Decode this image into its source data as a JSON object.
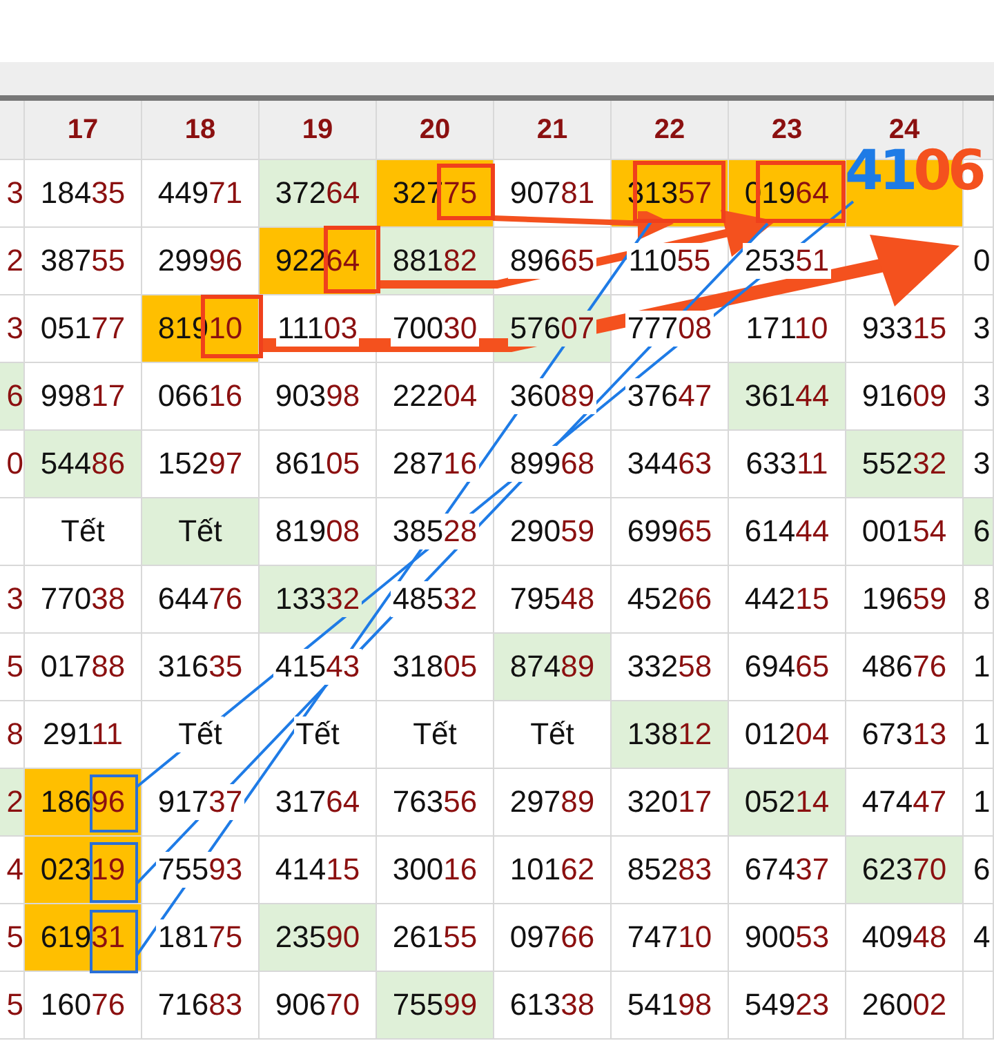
{
  "table": {
    "columns": [
      "17",
      "18",
      "19",
      "20",
      "21",
      "22",
      "23",
      "24"
    ],
    "rows": [
      {
        "left": {
          "value": "3"
        },
        "cells": [
          {
            "value": "18435"
          },
          {
            "value": "44971"
          },
          {
            "value": "37264",
            "color": "#dff0d8"
          },
          {
            "value": "32775",
            "color": "#ffbf00"
          },
          {
            "value": "90781"
          },
          {
            "value": "31357",
            "color": "#ffbf00"
          },
          {
            "value": "01964",
            "color": "#ffbf00"
          },
          {
            "color": "#ffbf00"
          }
        ]
      },
      {
        "left": {
          "value": "2"
        },
        "cells": [
          {
            "value": "38755"
          },
          {
            "value": "29996"
          },
          {
            "value": "92264",
            "color": "#ffbf00"
          },
          {
            "value": "88182",
            "color": "#dff0d8"
          },
          {
            "value": "89665"
          },
          {
            "value": "11055"
          },
          {
            "value": "25351"
          },
          {}
        ],
        "right": {
          "value": "0"
        }
      },
      {
        "left": {
          "value": "3"
        },
        "cells": [
          {
            "value": "05177"
          },
          {
            "value": "81910",
            "color": "#ffbf00"
          },
          {
            "value": "11103"
          },
          {
            "value": "70030"
          },
          {
            "value": "57607",
            "color": "#dff0d8"
          },
          {
            "value": "77708"
          },
          {
            "value": "17110"
          },
          {
            "value": "93315"
          }
        ],
        "right": {
          "value": "3"
        }
      },
      {
        "left": {
          "value": "6",
          "color": "#dff0d8"
        },
        "cells": [
          {
            "value": "99817"
          },
          {
            "value": "06616"
          },
          {
            "value": "90398"
          },
          {
            "value": "22204"
          },
          {
            "value": "36089"
          },
          {
            "value": "37647"
          },
          {
            "value": "36144",
            "color": "#dff0d8"
          },
          {
            "value": "91609"
          }
        ],
        "right": {
          "value": "3"
        }
      },
      {
        "left": {
          "value": "0"
        },
        "cells": [
          {
            "value": "54486",
            "color": "#dff0d8"
          },
          {
            "value": "15297"
          },
          {
            "value": "86105"
          },
          {
            "value": "28716"
          },
          {
            "value": "89968"
          },
          {
            "value": "34463"
          },
          {
            "value": "63311"
          },
          {
            "value": "55232",
            "color": "#dff0d8"
          }
        ],
        "right": {
          "value": "3"
        }
      },
      {
        "cells": [
          {
            "value": "Tết",
            "kind": "holiday"
          },
          {
            "value": "Tết",
            "kind": "holiday",
            "color": "#dff0d8"
          },
          {
            "value": "81908"
          },
          {
            "value": "38528"
          },
          {
            "value": "29059"
          },
          {
            "value": "69965"
          },
          {
            "value": "61444"
          },
          {
            "value": "00154"
          }
        ],
        "right": {
          "value": "6",
          "color": "#dff0d8"
        }
      },
      {
        "left": {
          "value": "3"
        },
        "cells": [
          {
            "value": "77038"
          },
          {
            "value": "64476"
          },
          {
            "value": "13332",
            "color": "#dff0d8"
          },
          {
            "value": "48532"
          },
          {
            "value": "79548"
          },
          {
            "value": "45266"
          },
          {
            "value": "44215"
          },
          {
            "value": "19659"
          }
        ],
        "right": {
          "value": "8"
        }
      },
      {
        "left": {
          "value": "5"
        },
        "cells": [
          {
            "value": "01788"
          },
          {
            "value": "31635"
          },
          {
            "value": "41543"
          },
          {
            "value": "31805"
          },
          {
            "value": "87489",
            "color": "#dff0d8"
          },
          {
            "value": "33258"
          },
          {
            "value": "69465"
          },
          {
            "value": "48676"
          }
        ],
        "right": {
          "value": "1"
        }
      },
      {
        "left": {
          "value": "8"
        },
        "cells": [
          {
            "value": "29111"
          },
          {
            "value": "Tết",
            "kind": "holiday"
          },
          {
            "value": "Tết",
            "kind": "holiday"
          },
          {
            "value": "Tết",
            "kind": "holiday"
          },
          {
            "value": "Tết",
            "kind": "holiday"
          },
          {
            "value": "13812",
            "color": "#dff0d8"
          },
          {
            "value": "01204"
          },
          {
            "value": "67313"
          }
        ],
        "right": {
          "value": "1"
        }
      },
      {
        "left": {
          "value": "2",
          "color": "#dff0d8"
        },
        "cells": [
          {
            "value": "18696",
            "color": "#ffbf00"
          },
          {
            "value": "91737"
          },
          {
            "value": "31764"
          },
          {
            "value": "76356"
          },
          {
            "value": "29789"
          },
          {
            "value": "32017"
          },
          {
            "value": "05214",
            "color": "#dff0d8"
          },
          {
            "value": "47447"
          }
        ],
        "right": {
          "value": "1"
        }
      },
      {
        "left": {
          "value": "4"
        },
        "cells": [
          {
            "value": "02319",
            "color": "#ffbf00"
          },
          {
            "value": "75593"
          },
          {
            "value": "41415"
          },
          {
            "value": "30016"
          },
          {
            "value": "10162"
          },
          {
            "value": "85283"
          },
          {
            "value": "67437"
          },
          {
            "value": "62370",
            "color": "#dff0d8"
          }
        ],
        "right": {
          "value": "6"
        }
      },
      {
        "left": {
          "value": "5"
        },
        "cells": [
          {
            "value": "61931",
            "color": "#ffbf00"
          },
          {
            "value": "18175"
          },
          {
            "value": "23590",
            "color": "#dff0d8"
          },
          {
            "value": "26155"
          },
          {
            "value": "09766"
          },
          {
            "value": "74710"
          },
          {
            "value": "90053"
          },
          {
            "value": "40948"
          }
        ],
        "right": {
          "value": "4"
        }
      },
      {
        "left": {
          "value": "5"
        },
        "cells": [
          {
            "value": "16076"
          },
          {
            "value": "71683"
          },
          {
            "value": "90670"
          },
          {
            "value": "75599",
            "color": "#dff0d8"
          },
          {
            "value": "61338"
          },
          {
            "value": "54198"
          },
          {
            "value": "54923"
          },
          {
            "value": "26002"
          }
        ]
      }
    ]
  },
  "annotation": [
    {
      "text": "41",
      "color": "#1e7be6"
    },
    {
      "text": "06",
      "color": "#f4511e"
    }
  ]
}
